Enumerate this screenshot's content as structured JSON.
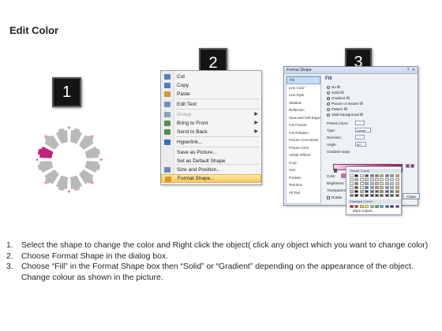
{
  "title": "Edit Color",
  "badges": [
    "1",
    "2",
    "3"
  ],
  "context_menu": {
    "items": [
      {
        "label": "Cut",
        "icon": "scissors-icon",
        "disabled": false,
        "submenu": false
      },
      {
        "label": "Copy",
        "icon": "copy-icon",
        "disabled": false,
        "submenu": false
      },
      {
        "label": "Paste",
        "icon": "paste-icon",
        "disabled": false,
        "submenu": false
      },
      {
        "label": "Edit Text",
        "icon": "edit-text-icon",
        "disabled": false,
        "submenu": false
      },
      {
        "label": "Group",
        "icon": "group-icon",
        "disabled": true,
        "submenu": true
      },
      {
        "label": "Bring to Front",
        "icon": "bring-front-icon",
        "disabled": false,
        "submenu": true
      },
      {
        "label": "Send to Back",
        "icon": "send-back-icon",
        "disabled": false,
        "submenu": true
      },
      {
        "label": "Hyperlink...",
        "icon": "hyperlink-icon",
        "disabled": false,
        "submenu": false
      },
      {
        "label": "Save as Picture...",
        "icon": "",
        "disabled": false,
        "submenu": false
      },
      {
        "label": "Set as Default Shape",
        "icon": "",
        "disabled": false,
        "submenu": false
      },
      {
        "label": "Size and Position...",
        "icon": "size-icon",
        "disabled": false,
        "submenu": false
      },
      {
        "label": "Format Shape...",
        "icon": "format-shape-icon",
        "disabled": false,
        "submenu": false,
        "active": true
      }
    ]
  },
  "format_dialog": {
    "title": "Format Shape",
    "categories": [
      "Fill",
      "Line Color",
      "Line Style",
      "Shadow",
      "Reflection",
      "Glow and Soft Edges",
      "3-D Format",
      "3-D Rotation",
      "Picture Corrections",
      "Picture Color",
      "Artistic Effects",
      "Crop",
      "Size",
      "Position",
      "Text Box",
      "Alt Text"
    ],
    "selected_category": "Fill",
    "section_heading": "Fill",
    "fill_options": [
      "No fill",
      "Solid fill",
      "Gradient fill",
      "Picture or texture fill",
      "Pattern fill",
      "Slide background fill"
    ],
    "selected_fill": "Gradient fill",
    "preset_colors_label": "Preset colors:",
    "type_label": "Type:",
    "type_value": "Linear",
    "direction_label": "Direction:",
    "angle_label": "Angle:",
    "angle_value": "90°",
    "gradient_stops_label": "Gradient stops",
    "color_label": "Color",
    "position_label": "Position:",
    "position_value": "0%",
    "brightness_label": "Brightness:",
    "transparency_label": "Transparency:",
    "rotate_label": "Rotate",
    "close_label": "Close"
  },
  "palette": {
    "theme_label": "Theme Colors",
    "standard_label": "Standard Colors",
    "more_label": "More Colors...",
    "theme_top": [
      "#ffffff",
      "#000000",
      "#eeece1",
      "#1f497d",
      "#4f81bd",
      "#c0504d",
      "#9bbb59",
      "#8064a2",
      "#4bacc6",
      "#f79646"
    ],
    "standard": [
      "#c00000",
      "#ff0000",
      "#ffc000",
      "#ffff00",
      "#92d050",
      "#00b050",
      "#00b0f0",
      "#0070c0",
      "#002060",
      "#7030a0"
    ]
  },
  "instructions": [
    {
      "num": "1.",
      "text": "Select the shape to change the color and Right click the object( click any object which you want to change color)"
    },
    {
      "num": "2.",
      "text": "Choose Format Shape in the dialog box."
    },
    {
      "num": "3.",
      "text": "Choose “Fill” in the Format Shape box then “Solid” or “Gradient” depending on the appearance of the object. Change colour as shown in the picture."
    }
  ],
  "colors": {
    "highlight_segment": "#c0257a",
    "gear_gray": "#b9b9b9",
    "menu_active": "#f8c860",
    "gradient_pink": "#e05aa8"
  }
}
